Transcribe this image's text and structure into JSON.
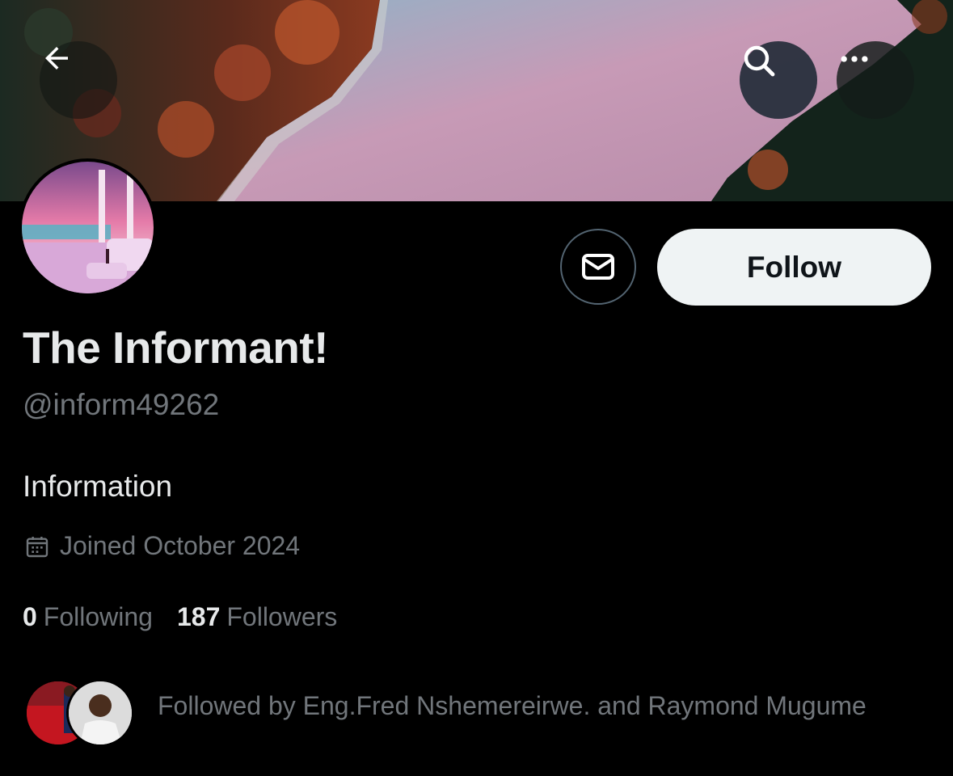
{
  "header": {
    "back_icon": "arrow-left-icon",
    "search_icon": "search-icon",
    "more_icon": "more-horizontal-icon"
  },
  "profile": {
    "display_name": "The Informant!",
    "handle": "@inform49262",
    "bio": "Information",
    "joined": "Joined October 2024",
    "joined_icon": "calendar-icon"
  },
  "actions": {
    "message_icon": "envelope-icon",
    "follow_label": "Follow"
  },
  "stats": {
    "following_count": "0",
    "following_label": "Following",
    "followers_count": "187",
    "followers_label": "Followers"
  },
  "followed_by": {
    "text": "Followed by Eng.Fred Nshemereirwe. and Raymond Mugume"
  },
  "colors": {
    "background": "#000000",
    "primary_text": "#e7e9ea",
    "secondary_text": "#71767b",
    "follow_button_bg": "#eff3f4",
    "border": "#536471"
  }
}
